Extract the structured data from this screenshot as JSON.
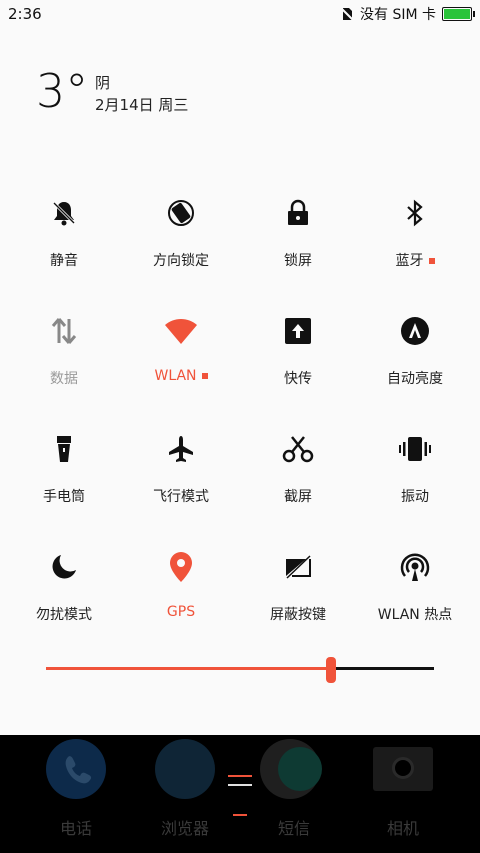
{
  "status": {
    "time": "2:36",
    "sim": "没有 SIM 卡"
  },
  "weather": {
    "temperature": "3°",
    "condition": "阴",
    "date": "2月14日 周三"
  },
  "tiles": [
    {
      "label": "静音"
    },
    {
      "label": "方向锁定"
    },
    {
      "label": "锁屏"
    },
    {
      "label": "蓝牙"
    },
    {
      "label": "数据"
    },
    {
      "label": "WLAN"
    },
    {
      "label": "快传"
    },
    {
      "label": "自动亮度"
    },
    {
      "label": "手电筒"
    },
    {
      "label": "飞行模式"
    },
    {
      "label": "截屏"
    },
    {
      "label": "振动"
    },
    {
      "label": "勿扰模式"
    },
    {
      "label": "GPS"
    },
    {
      "label": "屏蔽按键"
    },
    {
      "label": "WLAN 热点"
    }
  ],
  "brightness": {
    "level": 0.735
  },
  "dock": [
    {
      "label": "电话"
    },
    {
      "label": "浏览器"
    },
    {
      "label": "短信"
    },
    {
      "label": "相机"
    }
  ],
  "colors": {
    "accent": "#f0533a",
    "battery": "#29c43a"
  }
}
